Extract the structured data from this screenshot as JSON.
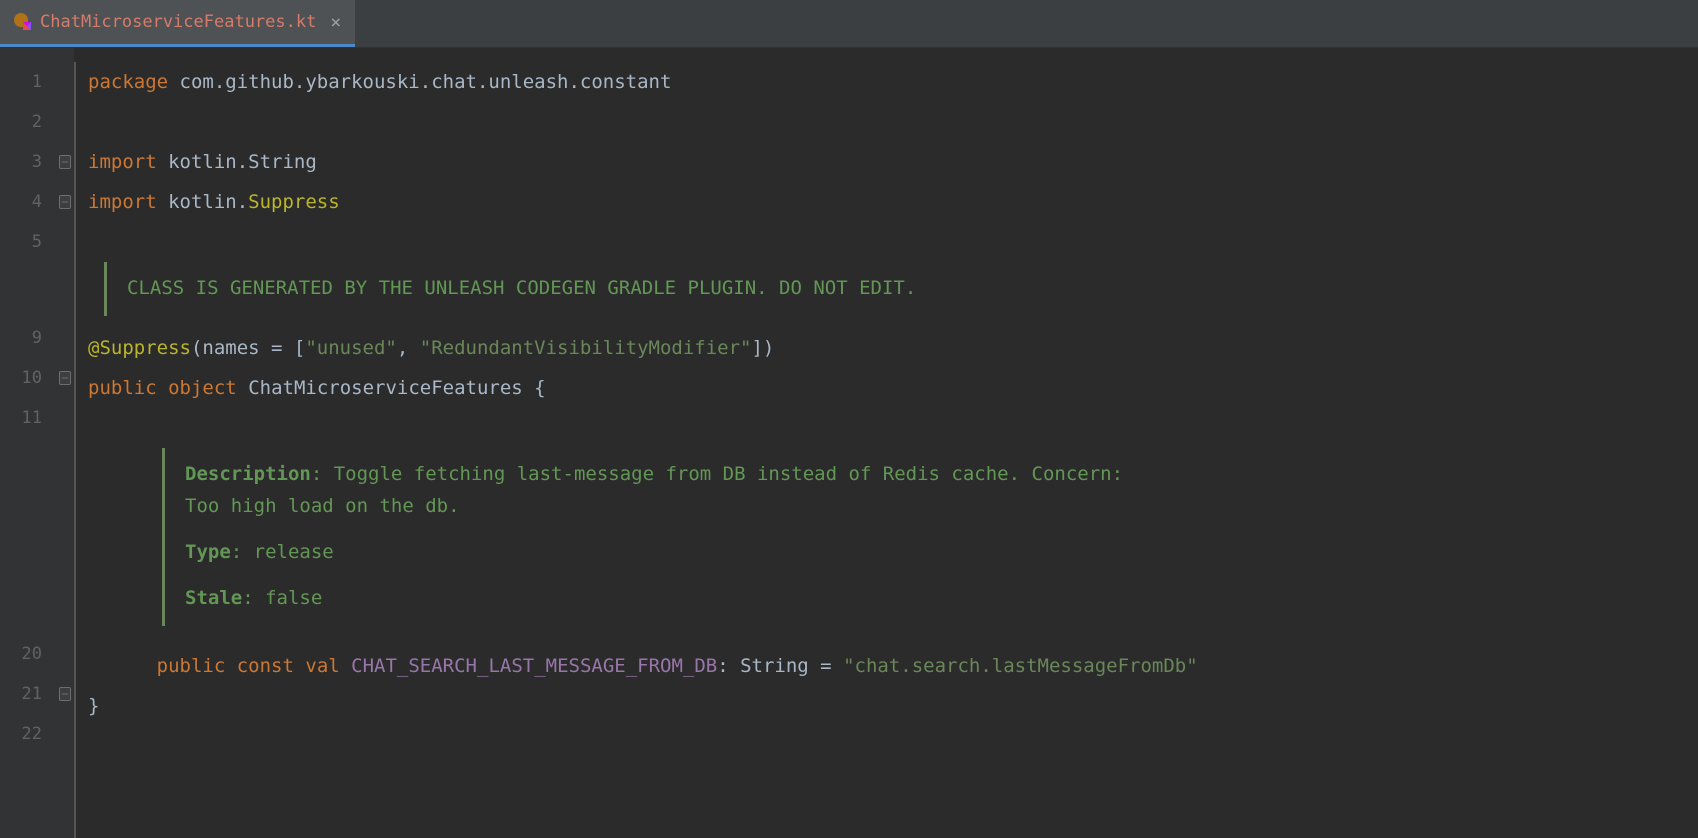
{
  "tab": {
    "filename": "ChatMicroserviceFeatures.kt",
    "close_glyph": "×"
  },
  "gutter_lines": [
    "1",
    "2",
    "3",
    "4",
    "5",
    "",
    "",
    "9",
    "10",
    "11",
    "",
    "",
    "",
    "",
    "",
    "20",
    "21",
    "22"
  ],
  "code": {
    "kw_package": "package",
    "package_path": "com.github.ybarkouski.chat.unleash.constant",
    "kw_import": "import",
    "import1_pkg": "kotlin.",
    "import1_cls": "String",
    "import2_pkg": "kotlin.",
    "import2_cls": "Suppress",
    "doc_class_comment": "CLASS IS GENERATED BY THE UNLEASH CODEGEN GRADLE PLUGIN. DO NOT EDIT.",
    "ann_suppress": "@Suppress",
    "ann_open": "(names = [",
    "str_unused": "\"unused\"",
    "ann_sep": ", ",
    "str_redundant": "\"RedundantVisibilityModifier\"",
    "ann_close": "])",
    "kw_public": "public",
    "kw_object": "object",
    "class_name": "ChatMicroserviceFeatures",
    "brace_open": " {",
    "brace_close": "}",
    "doc2": {
      "k_desc": "Description",
      "v_desc": ": Toggle fetching last-message from DB instead of Redis cache. Concern: Too high load on the db.",
      "k_type": "Type",
      "v_type": ": release",
      "k_stale": "Stale",
      "v_stale": ": false"
    },
    "kw_const": "const",
    "kw_val": "val",
    "const_name": "CHAT_SEARCH_LAST_MESSAGE_FROM_DB",
    "colon_type": ": String = ",
    "str_value": "\"chat.search.lastMessageFromDb\""
  }
}
